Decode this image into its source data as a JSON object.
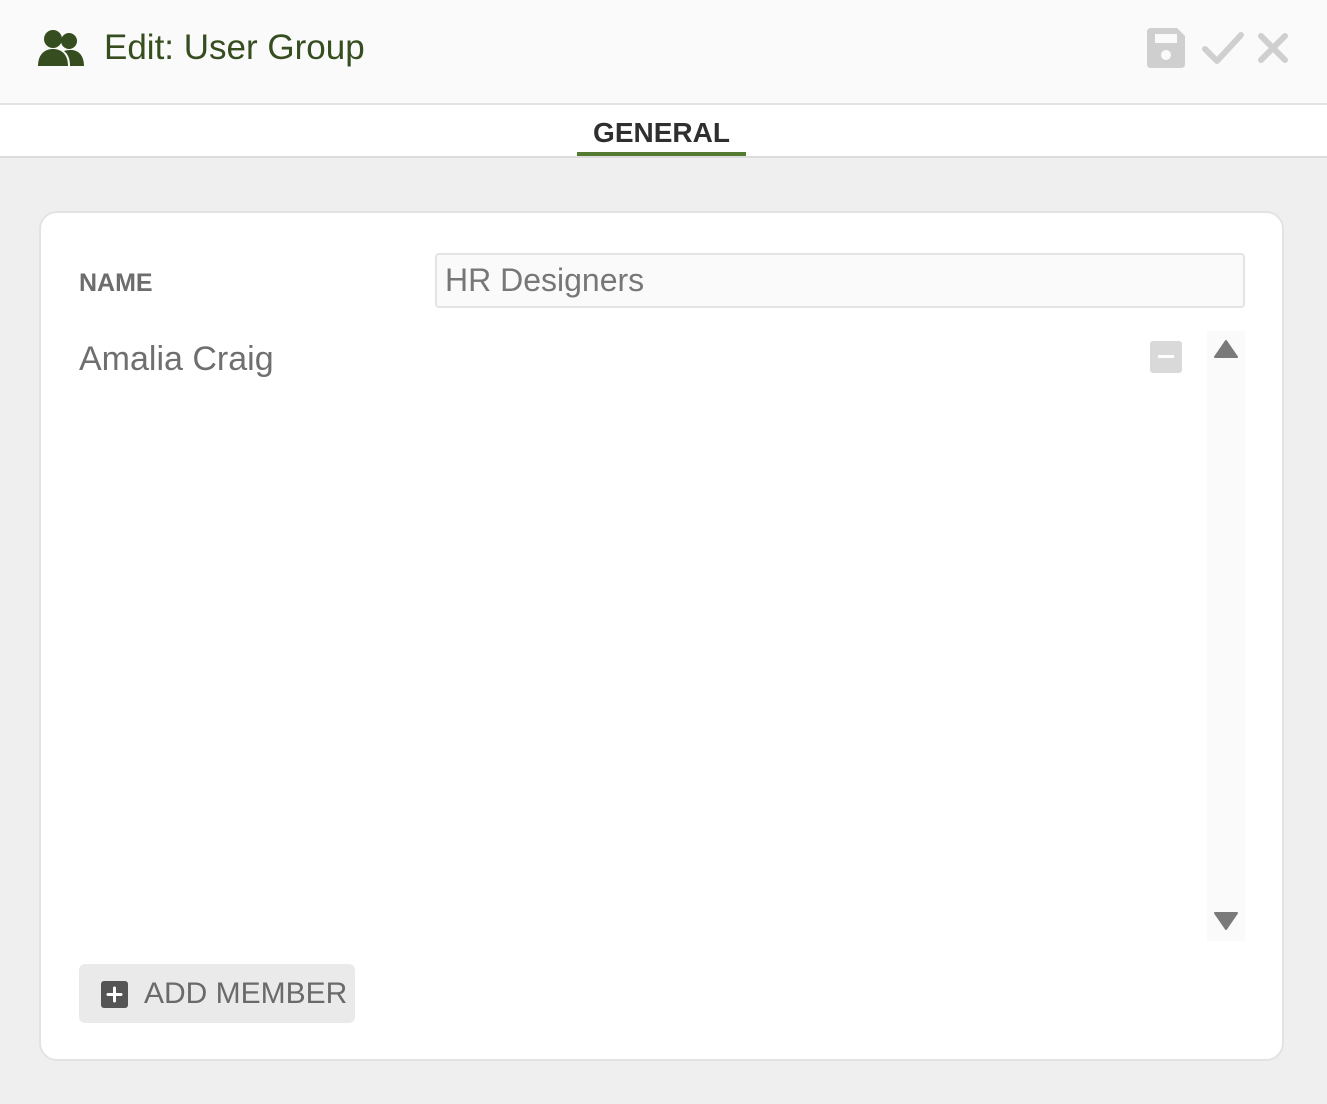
{
  "header": {
    "icon": "users-icon",
    "title": "Edit: User Group",
    "actions": [
      {
        "name": "save",
        "icon": "floppy-disk-icon"
      },
      {
        "name": "apply",
        "icon": "check-icon"
      },
      {
        "name": "close",
        "icon": "close-icon"
      }
    ]
  },
  "tabs": [
    {
      "label": "GENERAL",
      "active": true
    }
  ],
  "form": {
    "name_label": "NAME",
    "name_value": "HR Designers"
  },
  "members": [
    {
      "name": "Amalia Craig"
    }
  ],
  "add_member_label": "ADD MEMBER",
  "colors": {
    "accent": "#557a32",
    "title": "#364d1f",
    "icon_disabled": "#cfcfcf"
  }
}
